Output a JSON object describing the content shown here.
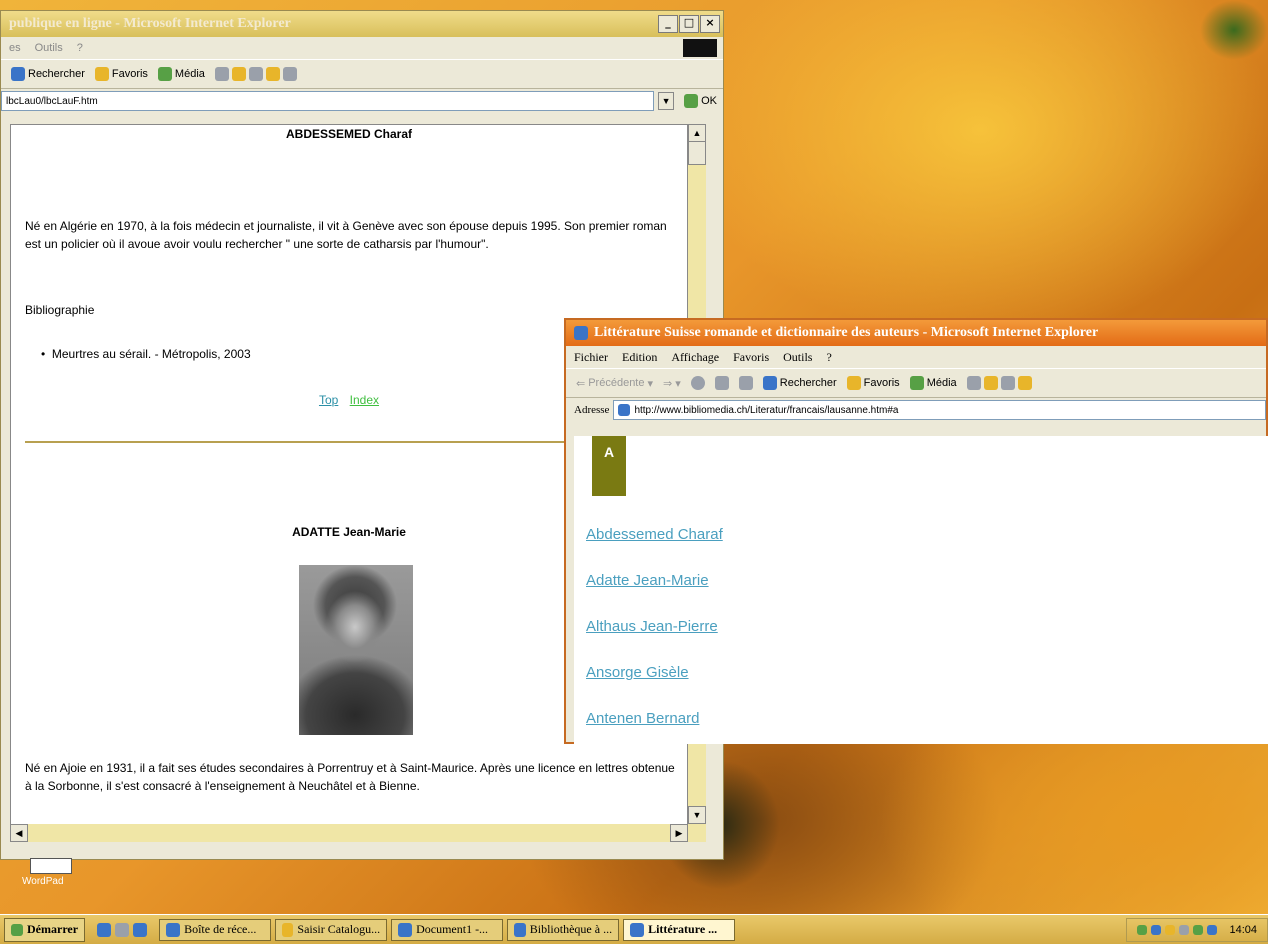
{
  "window_back": {
    "title": "publique en ligne - Microsoft Internet Explorer",
    "menu": [
      "es",
      "Outils",
      "?"
    ],
    "toolbar": [
      "Rechercher",
      "Favoris",
      "Média"
    ],
    "address": "lbcLau0/lbcLauF.htm",
    "go_label": "OK",
    "content": {
      "author1_name": "ABDESSEMED Charaf",
      "author1_bio": "Né en Algérie en 1970, à la fois médecin et journaliste, il vit à Genève avec son épouse depuis 1995. Son premier roman est un policier où il avoue avoir voulu rechercher \" une sorte de catharsis par l'humour\".",
      "bibliography_label": "Bibliographie",
      "book1": "Meurtres au sérail. - Métropolis, 2003",
      "top_link": "Top",
      "index_link": "Index",
      "author2_name": "ADATTE Jean-Marie",
      "author2_bio": "Né en Ajoie en 1931, il a fait ses études secondaires à Porrentruy et à Saint-Maurice. Après une licence en lettres obtenue à la Sorbonne, il s'est consacré à l'enseignement à Neuchâtel et à Bienne."
    }
  },
  "window_front": {
    "title": "Littérature Suisse romande et dictionnaire des auteurs - Microsoft Internet Explorer",
    "menu": [
      "Fichier",
      "Edition",
      "Affichage",
      "Favoris",
      "Outils",
      "?"
    ],
    "toolbar": {
      "back": "Précédente",
      "search": "Rechercher",
      "favorites": "Favoris",
      "media": "Média"
    },
    "address_label": "Adresse",
    "address": "http://www.bibliomedia.ch/Literatur/francais/lausanne.htm#a",
    "letter": "A",
    "authors": [
      "Abdessemed Charaf",
      "Adatte Jean-Marie",
      "Althaus Jean-Pierre",
      "Ansorge Gisèle",
      "Antenen Bernard"
    ]
  },
  "desktop": {
    "wordpad_label": "WordPad"
  },
  "taskbar": {
    "start": "Démarrer",
    "tasks": [
      "Boîte de réce...",
      "Saisir Catalogu...",
      "Document1 -...",
      "Bibliothèque à ...",
      "Littérature ..."
    ],
    "clock": "14:04"
  },
  "colors": {
    "title_active": "#e36b16",
    "title_inactive": "#d8bf5a",
    "link": "#4a9fbf",
    "top_link": "#2a8fa6",
    "index_link": "#3fbf3f",
    "letter_block": "#7a7a12"
  }
}
